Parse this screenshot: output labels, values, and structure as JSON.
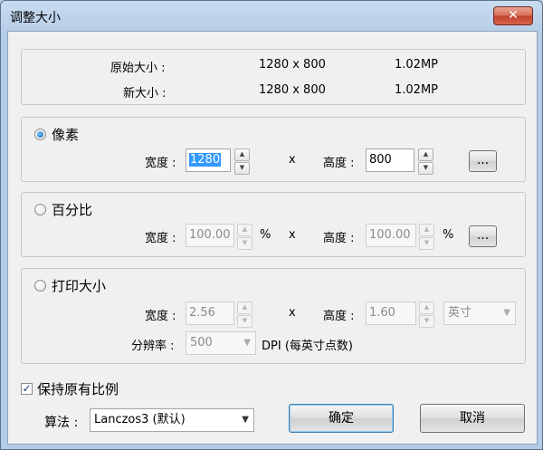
{
  "window": {
    "title": "调整大小",
    "close_label": "✕"
  },
  "info": {
    "original_label": "原始大小 :",
    "original_dims": "1280 x 800",
    "original_mp": "1.02MP",
    "new_label": "新大小 :",
    "new_dims": "1280 x 800",
    "new_mp": "1.02MP"
  },
  "pixels": {
    "title": "像素",
    "width_label": "宽度 :",
    "width_value": "1280",
    "x": "x",
    "height_label": "高度 :",
    "height_value": "800",
    "more_label": "..."
  },
  "percent": {
    "title": "百分比",
    "width_label": "宽度 :",
    "width_value": "100.00",
    "unit": "%",
    "x": "x",
    "height_label": "高度 :",
    "height_value": "100.00",
    "unit2": "%",
    "more_label": "..."
  },
  "print": {
    "title": "打印大小",
    "width_label": "宽度 :",
    "width_value": "2.56",
    "x": "x",
    "height_label": "高度 :",
    "height_value": "1.60",
    "unit_selected": "英寸",
    "resolution_label": "分辨率 :",
    "resolution_value": "500",
    "resolution_unit": "DPI (每英寸点数)"
  },
  "keep_ratio": {
    "label": "保持原有比例",
    "checked": true
  },
  "algorithm": {
    "label": "算法 :",
    "selected": "Lanczos3 (默认)"
  },
  "buttons": {
    "ok": "确定",
    "cancel": "取消"
  },
  "icons": {
    "spin_up": "up-arrow",
    "spin_down": "down-arrow",
    "dropdown": "chevron-down"
  }
}
